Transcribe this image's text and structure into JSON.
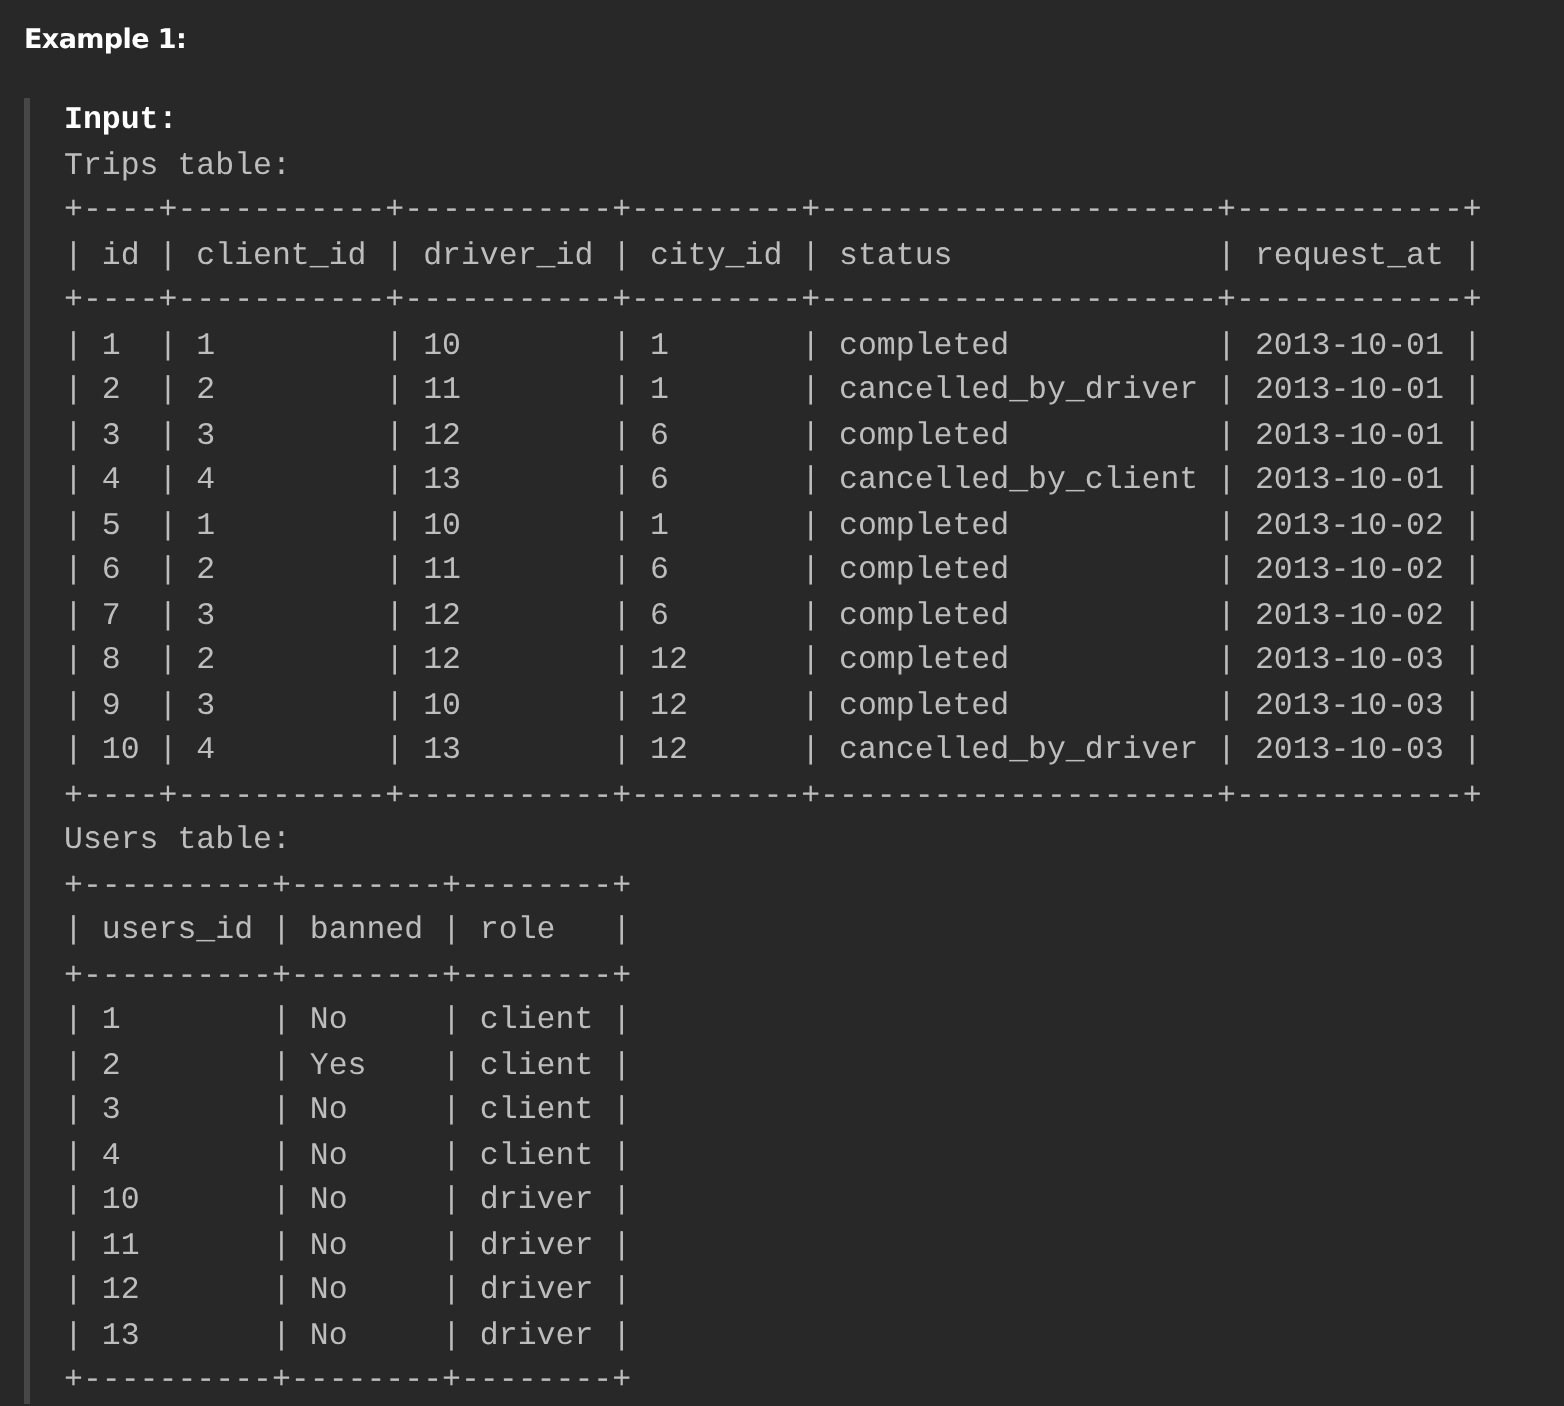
{
  "heading": "Example 1:",
  "input_label": "Input:",
  "tables": [
    {
      "title": "Trips table:",
      "lines": [
        "+----+-----------+-----------+---------+---------------------+------------+",
        "| id | client_id | driver_id | city_id | status              | request_at |",
        "+----+-----------+-----------+---------+---------------------+------------+",
        "| 1  | 1         | 10        | 1       | completed           | 2013-10-01 |",
        "| 2  | 2         | 11        | 1       | cancelled_by_driver | 2013-10-01 |",
        "| 3  | 3         | 12        | 6       | completed           | 2013-10-01 |",
        "| 4  | 4         | 13        | 6       | cancelled_by_client | 2013-10-01 |",
        "| 5  | 1         | 10        | 1       | completed           | 2013-10-02 |",
        "| 6  | 2         | 11        | 6       | completed           | 2013-10-02 |",
        "| 7  | 3         | 12        | 6       | completed           | 2013-10-02 |",
        "| 8  | 2         | 12        | 12      | completed           | 2013-10-03 |",
        "| 9  | 3         | 10        | 12      | completed           | 2013-10-03 |",
        "| 10 | 4         | 13        | 12      | cancelled_by_driver | 2013-10-03 |",
        "+----+-----------+-----------+---------+---------------------+------------+"
      ]
    },
    {
      "title": "Users table:",
      "lines": [
        "+----------+--------+--------+",
        "| users_id | banned | role   |",
        "+----------+--------+--------+",
        "| 1        | No     | client |",
        "| 2        | Yes    | client |",
        "| 3        | No     | client |",
        "| 4        | No     | client |",
        "| 10       | No     | driver |",
        "| 11       | No     | driver |",
        "| 12       | No     | driver |",
        "| 13       | No     | driver |",
        "+----------+--------+--------+"
      ]
    }
  ]
}
